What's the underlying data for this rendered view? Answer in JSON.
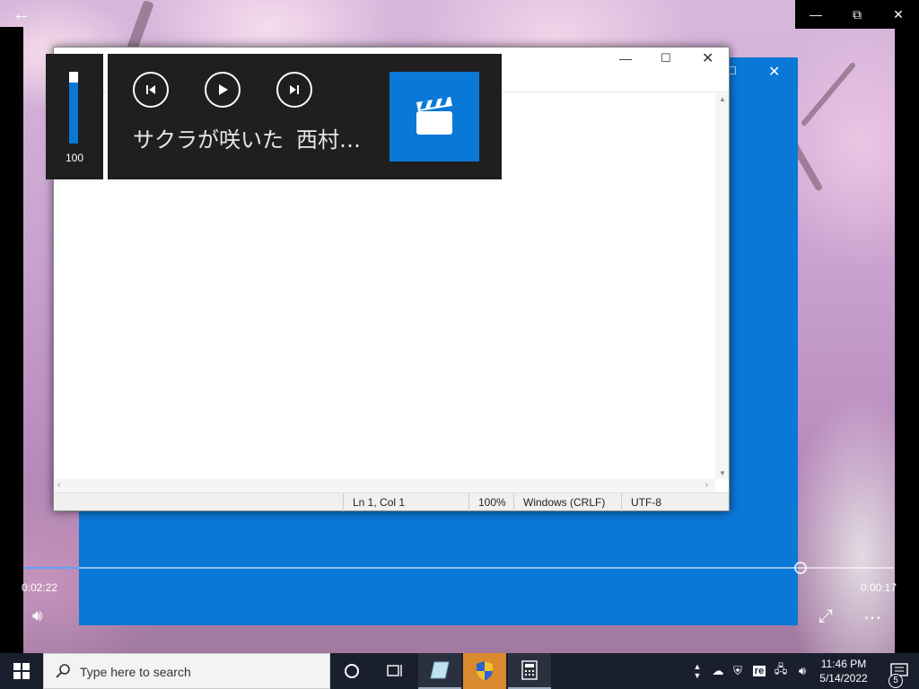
{
  "movies_app": {
    "time_elapsed": "0:02:22",
    "time_remaining": "0:00:17",
    "window_controls": {
      "minimize": "—",
      "restore": "⧉",
      "close": "✕"
    }
  },
  "media_overlay": {
    "volume_value": "100",
    "track_title": "サクラが咲いた",
    "track_artist": "西村…"
  },
  "notepad": {
    "title": "",
    "status": {
      "position": "Ln 1, Col 1",
      "zoom": "100%",
      "line_ending": "Windows (CRLF)",
      "encoding": "UTF-8"
    }
  },
  "taskbar": {
    "search_placeholder": "Type here to search",
    "clock_time": "11:46 PM",
    "clock_date": "5/14/2022",
    "notification_count": "5",
    "colors": {
      "taskbar_bg": "#1a1f2e",
      "active_app": "#d98a2e",
      "accent": "#0a78d7"
    }
  }
}
